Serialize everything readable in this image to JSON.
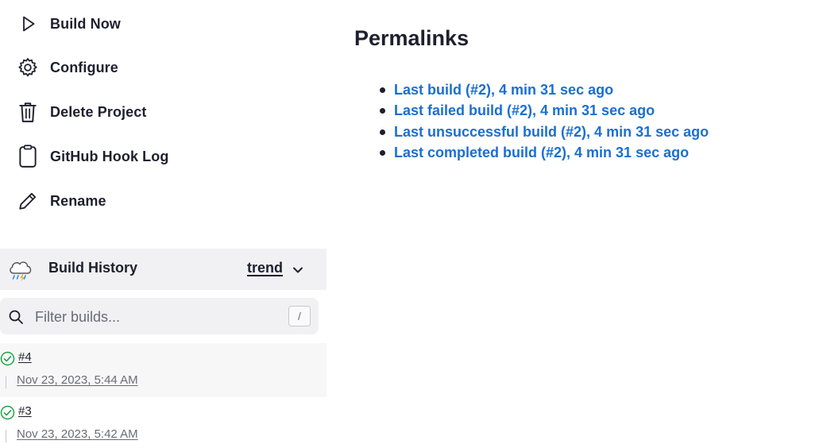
{
  "sidebar": {
    "tasks": [
      {
        "label": "Build Now",
        "icon": "play-icon"
      },
      {
        "label": "Configure",
        "icon": "gear-icon"
      },
      {
        "label": "Delete Project",
        "icon": "trash-icon"
      },
      {
        "label": "GitHub Hook Log",
        "icon": "clipboard-icon"
      },
      {
        "label": "Rename",
        "icon": "pencil-icon"
      }
    ]
  },
  "build_history": {
    "title": "Build History",
    "trend_label": "trend",
    "filter_placeholder": "Filter builds...",
    "filter_shortcut": "/",
    "builds": [
      {
        "number": "#4",
        "date": "Nov 23, 2023, 5:44 AM",
        "status": "success"
      },
      {
        "number": "#3",
        "date": "Nov 23, 2023, 5:42 AM",
        "status": "success"
      }
    ]
  },
  "main": {
    "title": "Permalinks",
    "links": [
      "Last build (#2), 4 min 31 sec ago",
      "Last failed build (#2), 4 min 31 sec ago",
      "Last unsuccessful build (#2), 4 min 31 sec ago",
      "Last completed build (#2), 4 min 31 sec ago"
    ]
  },
  "colors": {
    "link": "#1a6fd1",
    "success": "#1ea446",
    "panel_bg": "#f1f1f4",
    "text": "#1f1f2e"
  }
}
